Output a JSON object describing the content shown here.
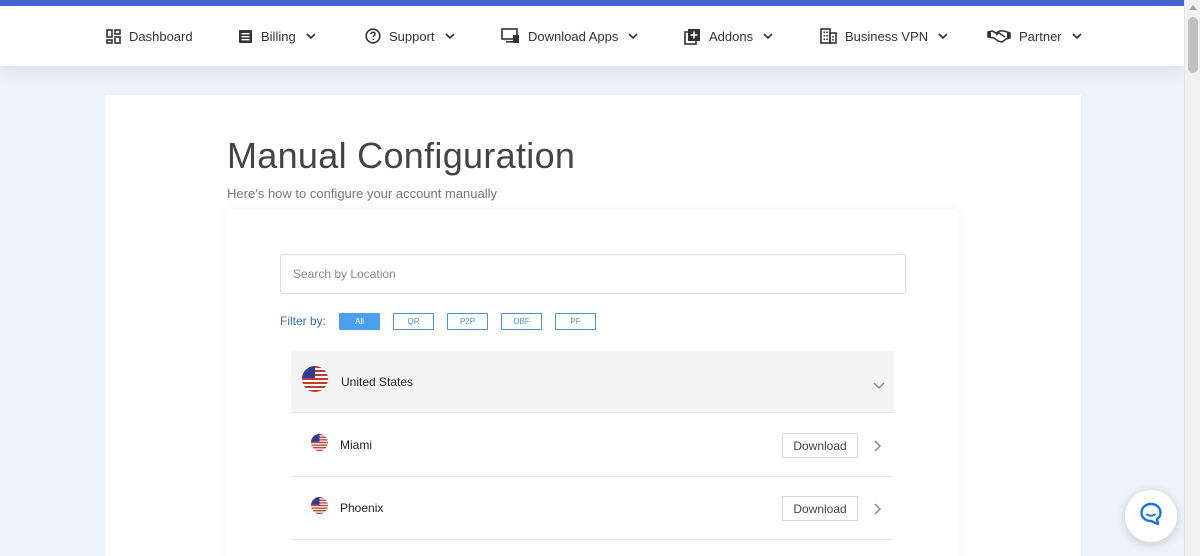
{
  "colors": {
    "accent_bar": "#4763cf",
    "filter_active": "#4a9ff0",
    "filter_border": "#4a90d9",
    "chat_icon": "#1a73e8",
    "page_background": "#eef2fb"
  },
  "nav": {
    "items": [
      {
        "label": "Dashboard",
        "icon": "dashboard-grid-icon",
        "has_dropdown": false
      },
      {
        "label": "Billing",
        "icon": "billing-list-icon",
        "has_dropdown": true
      },
      {
        "label": "Support",
        "icon": "question-circle-icon",
        "has_dropdown": true
      },
      {
        "label": "Download Apps",
        "icon": "monitor-download-icon",
        "has_dropdown": true
      },
      {
        "label": "Addons",
        "icon": "plus-box-icon",
        "has_dropdown": true
      },
      {
        "label": "Business VPN",
        "icon": "building-icon",
        "has_dropdown": true
      },
      {
        "label": "Partner",
        "icon": "handshake-icon",
        "has_dropdown": true
      }
    ]
  },
  "main": {
    "title": "Manual Configuration",
    "subtitle": "Here’s how to configure your account manually",
    "search": {
      "placeholder": "Search by Location",
      "value": ""
    },
    "filter": {
      "label": "Filter by:",
      "options": [
        "All",
        "QR",
        "P2P",
        "OBF",
        "PF"
      ],
      "selected": "All"
    },
    "locations": [
      {
        "country": "United States",
        "flag": "us-flag-icon",
        "expanded": true,
        "cities": [
          {
            "name": "Miami",
            "action": "Download"
          },
          {
            "name": "Phoenix",
            "action": "Download"
          }
        ]
      }
    ]
  },
  "chat": {
    "icon": "chat-bubble-icon"
  }
}
